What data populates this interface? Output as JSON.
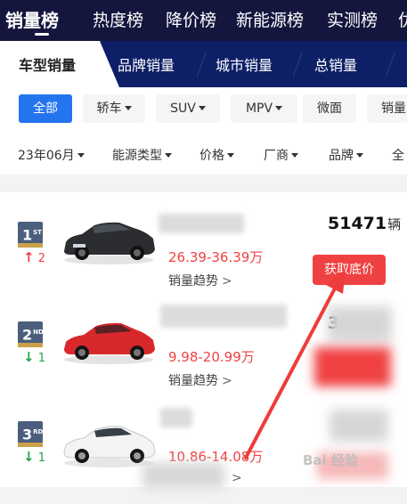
{
  "top_tabs": [
    "销量榜",
    "热度榜",
    "降价榜",
    "新能源榜",
    "实测榜",
    "优"
  ],
  "sub_tabs": [
    "车型销量",
    "品牌销量",
    "城市销量",
    "总销量"
  ],
  "chips": [
    "全部",
    "轿车",
    "SUV",
    "MPV",
    "微面",
    "销量"
  ],
  "filters": [
    "23年06月",
    "能源类型",
    "价格",
    "厂商",
    "品牌",
    "全"
  ],
  "rows": [
    {
      "rank": "1",
      "rank_suffix": "ST",
      "change": "2",
      "direction": "up",
      "price": "26.39-36.39万",
      "trend": "销量趋势",
      "sales": "51471",
      "unit": "辆",
      "button": "获取底价",
      "car_color": "#2b2d31"
    },
    {
      "rank": "2",
      "rank_suffix": "ND",
      "change": "1",
      "direction": "down",
      "price": "9.98-20.99万",
      "trend": "销量趋势",
      "sales": "30",
      "unit": "",
      "button": "",
      "car_color": "#d9282b"
    },
    {
      "rank": "3",
      "rank_suffix": "RD",
      "change": "1",
      "direction": "down",
      "price": "10.86-14.08万",
      "trend": "",
      "sales": "",
      "unit": "",
      "button": "",
      "car_color": "#f4f4f6"
    }
  ],
  "watermark": "Bai 经验",
  "colors": {
    "nav_bg": "#15163e",
    "subnav_bg": "#0d1f66",
    "accent_blue": "#2474f0",
    "price_red": "#f04142",
    "up_red": "#f04142",
    "down_green": "#1ea548",
    "arrow_red": "#ee3b3b"
  }
}
